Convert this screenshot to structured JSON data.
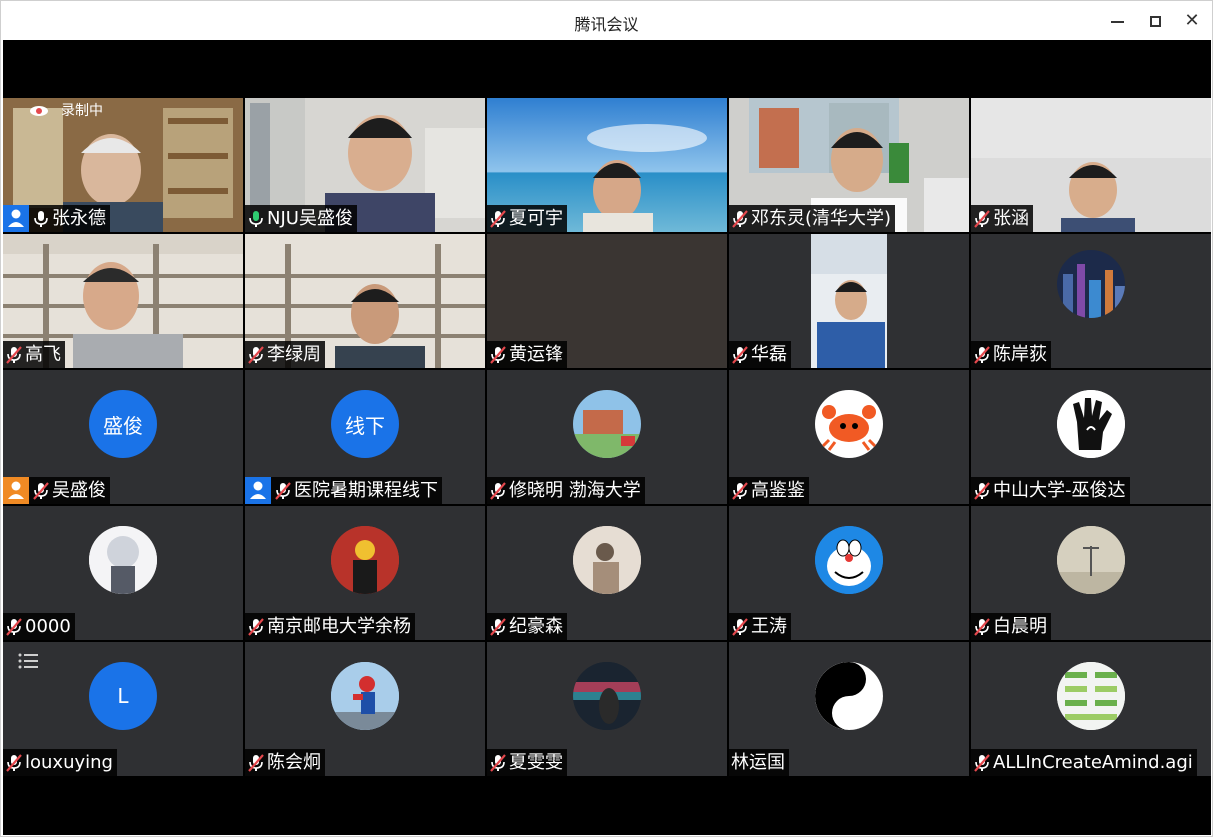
{
  "window": {
    "title": "腾讯会议"
  },
  "recording": {
    "label": "录制中"
  },
  "colors": {
    "accent": "#1a73e8",
    "tile_bg": "#2f3033",
    "mic_muted": "#e5484d",
    "host_badge": "#1a73e8",
    "cohost_badge": "#f08a24"
  },
  "participants": [
    {
      "name": "张永德",
      "role": "host",
      "mic": "on"
    },
    {
      "name": "NJU吴盛俊",
      "role": "",
      "mic": "active"
    },
    {
      "name": "夏可宇",
      "role": "",
      "mic": "muted"
    },
    {
      "name": "邓东灵(清华大学)",
      "role": "",
      "mic": "muted"
    },
    {
      "name": "张涵",
      "role": "",
      "mic": "muted"
    },
    {
      "name": "高飞",
      "role": "",
      "mic": "muted"
    },
    {
      "name": "李绿周",
      "role": "",
      "mic": "muted"
    },
    {
      "name": "黄运锋",
      "role": "",
      "mic": "muted"
    },
    {
      "name": "华磊",
      "role": "",
      "mic": "muted"
    },
    {
      "name": "陈岸荻",
      "role": "",
      "mic": "muted"
    },
    {
      "name": "吴盛俊",
      "role": "cohost",
      "mic": "muted",
      "avatar_text": "盛俊"
    },
    {
      "name": "医院暑期课程线下",
      "role": "host",
      "mic": "muted",
      "avatar_text": "线下"
    },
    {
      "name": "修晓明 渤海大学",
      "role": "",
      "mic": "muted"
    },
    {
      "name": "高鉴鉴",
      "role": "",
      "mic": "muted"
    },
    {
      "name": "中山大学-巫俊达",
      "role": "",
      "mic": "muted"
    },
    {
      "name": "0000",
      "role": "",
      "mic": "muted"
    },
    {
      "name": "南京邮电大学余杨",
      "role": "",
      "mic": "muted"
    },
    {
      "name": "纪豪森",
      "role": "",
      "mic": "muted"
    },
    {
      "name": "王涛",
      "role": "",
      "mic": "muted"
    },
    {
      "name": "白晨明",
      "role": "",
      "mic": "muted"
    },
    {
      "name": "louxuying",
      "role": "",
      "mic": "muted",
      "avatar_text": "L"
    },
    {
      "name": "陈会炯",
      "role": "",
      "mic": "muted"
    },
    {
      "name": "夏雯雯",
      "role": "",
      "mic": "muted"
    },
    {
      "name": "林运国",
      "role": "",
      "mic": "none"
    },
    {
      "name": "ALLInCreateAmind.agi",
      "role": "",
      "mic": "muted"
    }
  ]
}
